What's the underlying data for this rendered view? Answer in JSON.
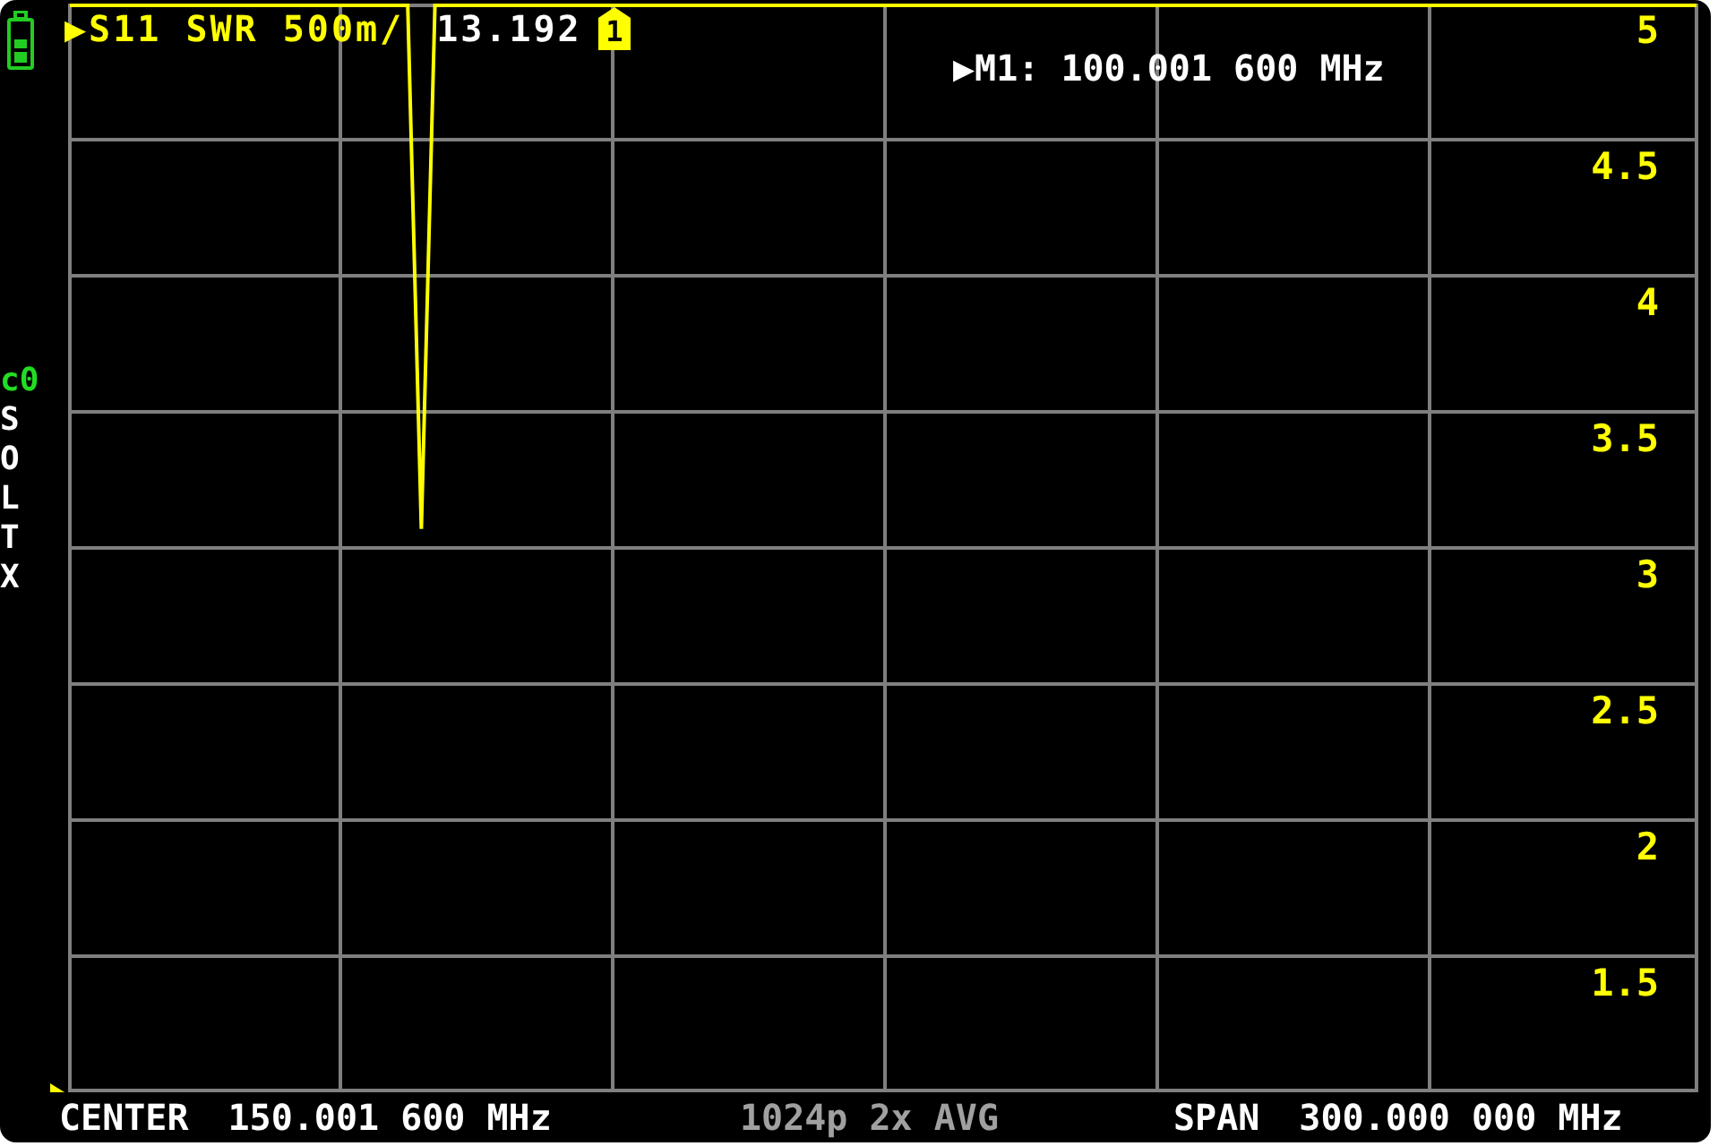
{
  "trace": {
    "label": "▶S11 SWR 500m/",
    "value": "13.192"
  },
  "marker": {
    "tag": "1",
    "readout": "▶M1: 100.001 600 MHz"
  },
  "calibration": {
    "status": "c0",
    "steps": [
      "S",
      "O",
      "L",
      "T",
      "X"
    ]
  },
  "chart_data": {
    "type": "line",
    "ylim": [
      1,
      5
    ],
    "grid": true,
    "yticks": [
      {
        "value": 5,
        "label": "5"
      },
      {
        "value": 4.5,
        "label": "4.5"
      },
      {
        "value": 4,
        "label": "4"
      },
      {
        "value": 3.5,
        "label": "3.5"
      },
      {
        "value": 3,
        "label": "3"
      },
      {
        "value": 2.5,
        "label": "2.5"
      },
      {
        "value": 2,
        "label": "2"
      },
      {
        "value": 1.5,
        "label": "1.5"
      }
    ],
    "categories": [
      null,
      null,
      null,
      null,
      null,
      null,
      null,
      null,
      null,
      null,
      null,
      null,
      null,
      null,
      null,
      null,
      null,
      null,
      null,
      null,
      null,
      null,
      null,
      null,
      null,
      null,
      null,
      null,
      null,
      null,
      null,
      null,
      null,
      null,
      null,
      null,
      null,
      null,
      null,
      null,
      null,
      null,
      null,
      null,
      null,
      null,
      null,
      null,
      null,
      null,
      null,
      null,
      null,
      null,
      null,
      null,
      null,
      null,
      null,
      null,
      null,
      null,
      null,
      null,
      null,
      null,
      null,
      null,
      null,
      null,
      null,
      null,
      null,
      null,
      null,
      null,
      null,
      null,
      null,
      null,
      null,
      null,
      null,
      null,
      null,
      null,
      null,
      null,
      null,
      null,
      null,
      null,
      null,
      null,
      null,
      null,
      null,
      null,
      null,
      null,
      null,
      null,
      null,
      null,
      null,
      null,
      null,
      null,
      null,
      null,
      null,
      null,
      null,
      null,
      null,
      null,
      null,
      null,
      null,
      null,
      null
    ],
    "series": [
      {
        "color": "#ffff00",
        "values": [
          5,
          5,
          5,
          5,
          5,
          5,
          5,
          5,
          5,
          5,
          5,
          5,
          5,
          5,
          5,
          5,
          5,
          5,
          5,
          5,
          5,
          5,
          5,
          5,
          5,
          5,
          3.07,
          5,
          5,
          5,
          5,
          5,
          5,
          5,
          5,
          5,
          5,
          5,
          5,
          5,
          5,
          5,
          5,
          5,
          5,
          5,
          5,
          5,
          5,
          5,
          5,
          5,
          5,
          5,
          5,
          5,
          5,
          5,
          5,
          5,
          5,
          5,
          5,
          5,
          5,
          5,
          5,
          5,
          5,
          5,
          5,
          5,
          5,
          5,
          5,
          5,
          5,
          5,
          5,
          5,
          5,
          5,
          5,
          5,
          5,
          5,
          5,
          5,
          5,
          5,
          5,
          5,
          5,
          5,
          5,
          5,
          5,
          5,
          5,
          5,
          5,
          5,
          5,
          5,
          5,
          5,
          5,
          5,
          5,
          5,
          5,
          5,
          5,
          5,
          5,
          5,
          5,
          5,
          5,
          5,
          5
        ]
      }
    ]
  },
  "footer": {
    "center_label": "CENTER",
    "center_value": "150.001 600 MHz",
    "points": "1024p 2x AVG",
    "span_label": "SPAN",
    "span_value": "300.000 000 MHz"
  }
}
